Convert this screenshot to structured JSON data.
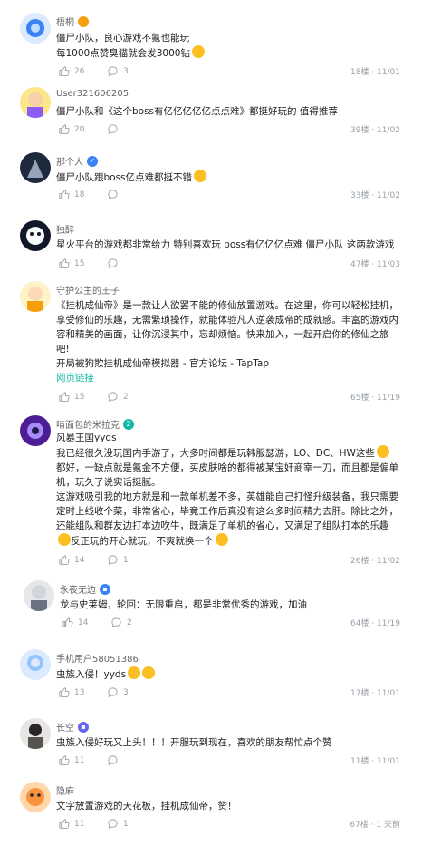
{
  "comments": [
    {
      "name": "梧桐",
      "lines": [
        "僵尸小队，良心游戏不氪也能玩",
        "每1000点赞臭猫就会发3000钻"
      ],
      "likes": "26",
      "replies": "3",
      "meta": "18楼 · 11/01"
    },
    {
      "name": "User321606205",
      "lines": [
        "僵尸小队和《这个boss有亿亿亿亿亿点点难》都挺好玩的 值得推荐"
      ],
      "likes": "20",
      "replies": "",
      "meta": "39楼 · 11/02"
    },
    {
      "name": "那个人",
      "lines": [
        "僵尸小队跟boss亿点难都挺不错"
      ],
      "likes": "18",
      "replies": "",
      "meta": "33楼 · 11/02"
    },
    {
      "name": "独醉",
      "lines": [
        "星火平台的游戏都非常给力 特别喜欢玩 boss有亿亿亿点难  僵尸小队  这两款游戏"
      ],
      "likes": "15",
      "replies": "",
      "meta": "47楼 · 11/03"
    },
    {
      "name": "守护公主的王子",
      "lines": [
        "《挂机成仙帝》是一款让人欲罢不能的修仙放置游戏。在这里，你可以轻松挂机，",
        "享受修仙的乐趣，无需繁琐操作，就能体验凡人逆袭成帝的成就感。丰富的游戏内",
        "容和精美的画面，让你沉浸其中，忘却烦恼。快来加入，一起开启你的修仙之旅",
        "吧!",
        "开局被狗欺挂机成仙帝模拟器 - 官方论坛 - TapTap"
      ],
      "link": "网页链接",
      "likes": "15",
      "replies": "2",
      "meta": "65楼 · 11/19"
    },
    {
      "name": "啃面包的米拉克",
      "lines": [
        "风暴王国yyds",
        "我已经很久没玩国内手游了，大多时间都是玩韩服瑟游，LO、DC、HW这些",
        "都好，一缺点就是氪金不方便，买皮肤啥的都得被某宝奸商宰一刀，而且都是偏单",
        "机，玩久了说实话挺腻。",
        "这游戏吸引我的地方就是和一款单机差不多，英雄能自己打怪升级装备，我只需要",
        "定时上线收个菜，非常省心，毕竟工作后真没有这么多时间精力去肝。除比之外，",
        "还能组队和群友边打本边吹牛，既满足了单机的省心，又满足了组队打本的乐趣",
        "反正玩的开心就玩，不爽就换一个"
      ],
      "likes": "14",
      "replies": "1",
      "meta": "26楼 · 11/02"
    },
    {
      "name": "永夜无边",
      "lines": [
        "龙与史莱姆，轮回：无限重启，都是非常优秀的游戏，加油"
      ],
      "likes": "14",
      "replies": "2",
      "meta": "64楼 · 11/19"
    },
    {
      "name": "手机用户58051386",
      "lines": [
        "虫族入侵！yyds"
      ],
      "likes": "13",
      "replies": "3",
      "meta": "17楼 · 11/01"
    },
    {
      "name": "长空",
      "lines": [
        "虫族入侵好玩又上头！！！开服玩到现在，喜欢的朋友帮忙点个赞"
      ],
      "likes": "11",
      "replies": "",
      "meta": "11楼 · 11/01"
    },
    {
      "name": "隐麻",
      "lines": [
        "文字放置游戏的天花板，挂机成仙帝，赞！"
      ],
      "likes": "11",
      "replies": "1",
      "meta": "67楼 · 1 天前"
    }
  ]
}
